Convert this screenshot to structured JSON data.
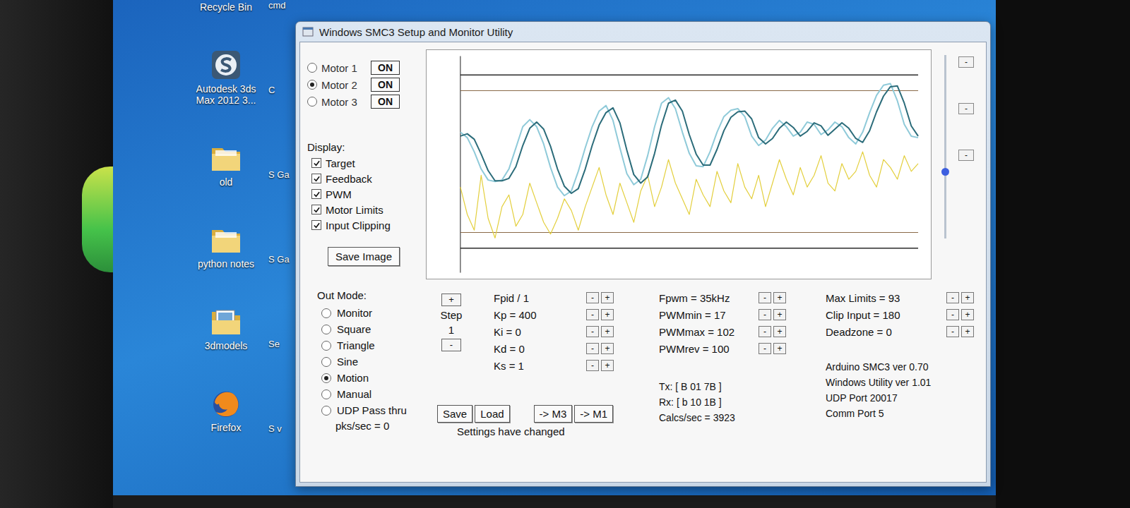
{
  "desktop": {
    "icons": [
      {
        "label": "Recycle Bin",
        "kind": "label-only"
      },
      {
        "label": "Autodesk 3ds Max 2012 3...",
        "kind": "app"
      },
      {
        "label": "old",
        "kind": "folder"
      },
      {
        "label": "python notes",
        "kind": "folder"
      },
      {
        "label": "3dmodels",
        "kind": "image-folder"
      },
      {
        "label": "Firefox",
        "kind": "browser"
      }
    ],
    "partial_icons": [
      "cmd",
      "C",
      "S Ga",
      "S Ga",
      "Se",
      "S v"
    ]
  },
  "window": {
    "title": "Windows SMC3 Setup and Monitor Utility"
  },
  "motors": [
    {
      "label": "Motor 1",
      "selected": false,
      "button": "ON"
    },
    {
      "label": "Motor 2",
      "selected": true,
      "button": "ON"
    },
    {
      "label": "Motor 3",
      "selected": false,
      "button": "ON"
    }
  ],
  "display": {
    "label": "Display:",
    "items": [
      {
        "label": "Target",
        "checked": true
      },
      {
        "label": "Feedback",
        "checked": true
      },
      {
        "label": "PWM",
        "checked": true
      },
      {
        "label": "Motor Limits",
        "checked": true
      },
      {
        "label": "Input Clipping",
        "checked": true
      }
    ]
  },
  "save_image": "Save Image",
  "chart": {
    "y_min": 0,
    "y_max": 255,
    "series": [
      {
        "color": "#8fcad9",
        "values": [
          165,
          158,
          140,
          118,
          104,
          102,
          104,
          118,
          145,
          172,
          181,
          172,
          150,
          120,
          95,
          84,
          90,
          115,
          145,
          172,
          192,
          199,
          180,
          145,
          112,
          98,
          105,
          135,
          172,
          202,
          209,
          195,
          165,
          138,
          122,
          121,
          140,
          165,
          185,
          193,
          195,
          185,
          160,
          148,
          155,
          170,
          180,
          172,
          160,
          165,
          178,
          175,
          162,
          168,
          178,
          172,
          158,
          150,
          165,
          190,
          212,
          225,
          227,
          205,
          175,
          160,
          158
        ]
      },
      {
        "color": "#2b6c7a",
        "values": [
          160,
          163,
          156,
          137,
          116,
          103,
          103,
          106,
          121,
          148,
          170,
          178,
          169,
          147,
          118,
          96,
          87,
          93,
          118,
          148,
          174,
          190,
          196,
          177,
          142,
          111,
          100,
          108,
          138,
          174,
          202,
          206,
          192,
          162,
          137,
          123,
          123,
          143,
          167,
          184,
          191,
          192,
          182,
          158,
          150,
          157,
          170,
          178,
          171,
          160,
          166,
          177,
          173,
          161,
          169,
          177,
          170,
          157,
          152,
          167,
          191,
          211,
          223,
          224,
          202,
          173,
          160
        ]
      },
      {
        "color": "#e3cf3c",
        "values": [
          95,
          60,
          40,
          110,
          55,
          30,
          70,
          85,
          45,
          60,
          100,
          75,
          50,
          35,
          55,
          80,
          65,
          40,
          70,
          95,
          120,
          85,
          60,
          100,
          75,
          50,
          90,
          110,
          70,
          95,
          130,
          100,
          80,
          60,
          105,
          85,
          70,
          115,
          90,
          75,
          125,
          95,
          80,
          110,
          70,
          100,
          130,
          105,
          85,
          120,
          95,
          110,
          135,
          100,
          90,
          125,
          105,
          115,
          140,
          110,
          95,
          130,
          120,
          105,
          135,
          115,
          125
        ]
      }
    ],
    "motor_limits": [
      238,
      17
    ],
    "input_clipping": [
      218,
      37
    ]
  },
  "slider": {
    "level": 0.36
  },
  "side_buttons": [
    "-",
    "-",
    "-"
  ],
  "out_mode": {
    "label": "Out Mode:",
    "options": [
      {
        "label": "Monitor",
        "selected": false
      },
      {
        "label": "Square",
        "selected": false
      },
      {
        "label": "Triangle",
        "selected": false
      },
      {
        "label": "Sine",
        "selected": false
      },
      {
        "label": "Motion",
        "selected": true
      },
      {
        "label": "Manual",
        "selected": false
      },
      {
        "label": "UDP Pass thru",
        "selected": false
      }
    ],
    "pks": "pks/sec = 0"
  },
  "step": {
    "increment": "+",
    "label": "Step",
    "value": "1",
    "decrement": "-"
  },
  "adjust_buttons": [
    "-",
    "+"
  ],
  "pid": [
    "Fpid / 1",
    "Kp = 400",
    "Ki = 0",
    "Kd = 0",
    "Ks = 1"
  ],
  "pwm": [
    "Fpwm = 35kHz",
    "PWMmin = 17",
    "PWMmax = 102",
    "PWMrev = 100"
  ],
  "limits": [
    "Max Limits = 93",
    "Clip Input = 180",
    "Deadzone = 0"
  ],
  "file_buttons": [
    "Save",
    "Load"
  ],
  "copy_buttons": [
    "-> M3",
    "-> M1"
  ],
  "status": "Settings have changed",
  "comms": [
    "Tx: [ B 01 7B ]",
    "Rx: [ b 10 1B ]",
    "Calcs/sec = 3923"
  ],
  "versions": [
    "Arduino SMC3 ver 0.70",
    "Windows Utility ver 1.01",
    "UDP Port 20017",
    "Comm Port 5"
  ]
}
